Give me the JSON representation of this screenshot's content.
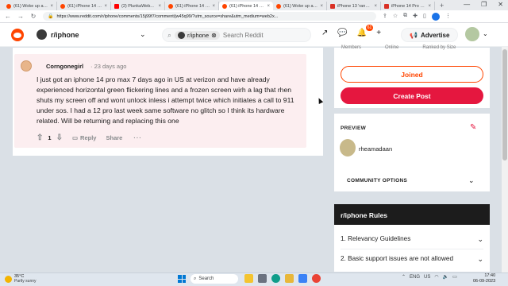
{
  "browser": {
    "tabs": [
      {
        "title": "(61) Woke up and...",
        "color": "#ff4500",
        "active": false
      },
      {
        "title": "(61) iPhone 14 pr...",
        "color": "#ff4500",
        "active": false
      },
      {
        "title": "(2) PlunkaWeb...",
        "color": "#ff0000",
        "active": false
      },
      {
        "title": "(61) iPhone 14 pr...",
        "color": "#ff4500",
        "active": false
      },
      {
        "title": "(61) iPhone 14 pr...",
        "color": "#ff4500",
        "active": true
      },
      {
        "title": "(61) Woke up and...",
        "color": "#ff4500",
        "active": false
      },
      {
        "title": "iPhone 13 'rando...",
        "color": "#d93025",
        "active": false
      },
      {
        "title": "iPhone 14 Pro M...",
        "color": "#d93025",
        "active": false
      }
    ],
    "new_tab": "+",
    "url": "https://www.reddit.com/r/iphone/comments/15j99f7/comment/jw45q99/?utm_source=share&utm_medium=web2x...",
    "window_controls": [
      "—",
      "❐",
      "✕"
    ]
  },
  "header": {
    "subreddit": "r/iphone",
    "search_chip": "r/iphone",
    "search_placeholder": "Search Reddit",
    "notification_count": "61",
    "advertise_label": "Advertise"
  },
  "comment": {
    "username": "Corngonegirl",
    "time": "· 23 days ago",
    "body": "I just got an iphone 14 pro max 7 days ago in US at verizon and have already experienced horizontal green flickering lines and a frozen screen wirh a lag that rhen shuts my screen off and wont unlock inless i attempt twice which initiates a call to 911 under sos. I had a 12 pro last week same software no glitch so I think its hardware related. Will be returning and replacing this one",
    "score": "1",
    "reply_label": "Reply",
    "share_label": "Share",
    "more_label": "···"
  },
  "sidebar": {
    "stats": [
      "Members",
      "Online",
      "Ranked by Size"
    ],
    "joined_label": "Joined",
    "create_post_label": "Create Post",
    "preview_label": "PREVIEW",
    "preview_user": "rheamadaan",
    "community_options_label": "COMMUNITY OPTIONS",
    "rules_title": "r/iphone Rules",
    "rules": [
      "1. Relevancy Guidelines",
      "2. Basic support issues are not allowed"
    ]
  },
  "taskbar": {
    "temperature": "35°C",
    "condition": "Partly sunny",
    "search_label": "Search",
    "lang": "ENG",
    "region": "US",
    "time": "17:40",
    "date": "06-09-2023"
  },
  "colors": {
    "reddit_orange": "#ff4500",
    "create_post_red": "#e5173f",
    "comment_bg": "#fceef0"
  }
}
